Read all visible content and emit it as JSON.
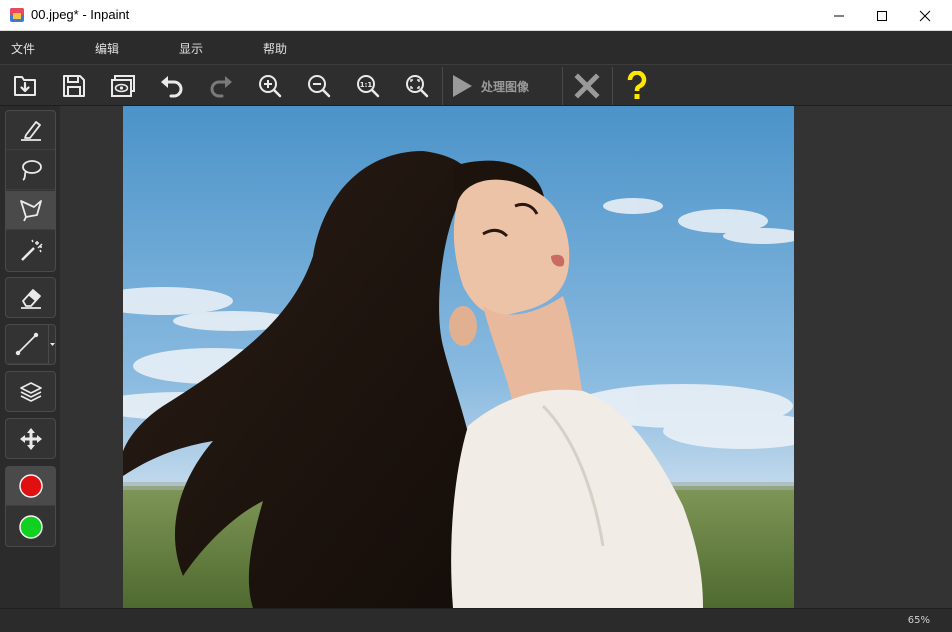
{
  "window": {
    "title": "00.jpeg* - Inpaint",
    "app_icon": "inpaint-app-icon"
  },
  "menu": {
    "items": [
      {
        "label": "文件"
      },
      {
        "label": "编辑"
      },
      {
        "label": "显示"
      },
      {
        "label": "帮助"
      }
    ]
  },
  "toolbar": {
    "buttons": [
      {
        "icon": "open-icon"
      },
      {
        "icon": "save-icon"
      },
      {
        "icon": "save-as-icon"
      },
      {
        "icon": "undo-icon"
      },
      {
        "icon": "redo-icon"
      },
      {
        "icon": "zoom-in-icon"
      },
      {
        "icon": "zoom-out-icon"
      },
      {
        "icon": "actual-size-icon"
      },
      {
        "icon": "fit-window-icon"
      }
    ],
    "process_label": "处理图像",
    "cancel_icon": "close-x-icon",
    "help_icon": "help-icon"
  },
  "tools": [
    {
      "icon": "marker-icon"
    },
    {
      "icon": "lasso-icon"
    },
    {
      "icon": "polygon-lasso-icon"
    },
    {
      "icon": "magic-wand-icon"
    },
    {
      "icon": "eraser-icon"
    },
    {
      "icon": "line-icon"
    },
    {
      "icon": "layers-icon"
    },
    {
      "icon": "move-icon"
    },
    {
      "icon": "red-marker-color",
      "color": "#e01010"
    },
    {
      "icon": "green-marker-color",
      "color": "#10d020"
    }
  ],
  "status": {
    "zoom": "65%"
  },
  "colors": {
    "background": "#2b2b2b",
    "help_yellow": "#ffe800",
    "marker_red": "#e01010",
    "marker_green": "#10d020"
  }
}
